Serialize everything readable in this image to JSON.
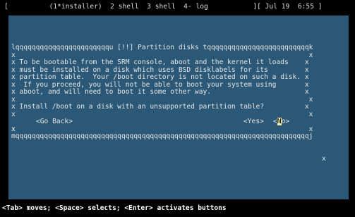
{
  "tmux": {
    "status_line": "[          (1*installer)  2 shell  3 shell  4- log           ][ Jul 19  6:55 ]"
  },
  "dialog": {
    "top_border": "lqqqqqqqqqqqqqqqqqqqqqqqu [!!] Partition disks tqqqqqqqqqqqqqqqqqqqqqqqqqk",
    "lines": [
      "x                                                                        x",
      "x To be bootable from the SRM console, aboot and the kernel it loads    x",
      "x must be installed on a disk which uses BSD disklabels for its         x",
      "x partition table.  Your /boot directory is not located on such a disk. x",
      "x  If you proceed, you will not be able to boot your system using       x",
      "x aboot, and will need to boot it some other way.                       x",
      "x                                                                        x",
      "x Install /boot on a disk with an unsupported partition table?          x",
      "x                                                                        x"
    ],
    "buttons_line_left": "x",
    "buttons_line_right": "x",
    "go_back_label": "<Go Back>",
    "yes_label": "<Yes>",
    "no_label_pre": "<",
    "no_label_cursor": "N",
    "no_label_post": "o>",
    "after_buttons_line": "x                                                                        x",
    "bottom_border": "mqqqqqqqqqqqqqqqqqqqqqqqqqqqqqqqqqqqqqqqqqqqqqqqqqqqqqqqqqqqqqqqqqqqqqqqqj"
  },
  "footer": {
    "help_text": "<Tab> moves; <Space> selects; <Enter> activates buttons"
  },
  "colors": {
    "background": "#000000",
    "panel": "#2b5876",
    "cursor_highlight": "#fff0a6"
  }
}
